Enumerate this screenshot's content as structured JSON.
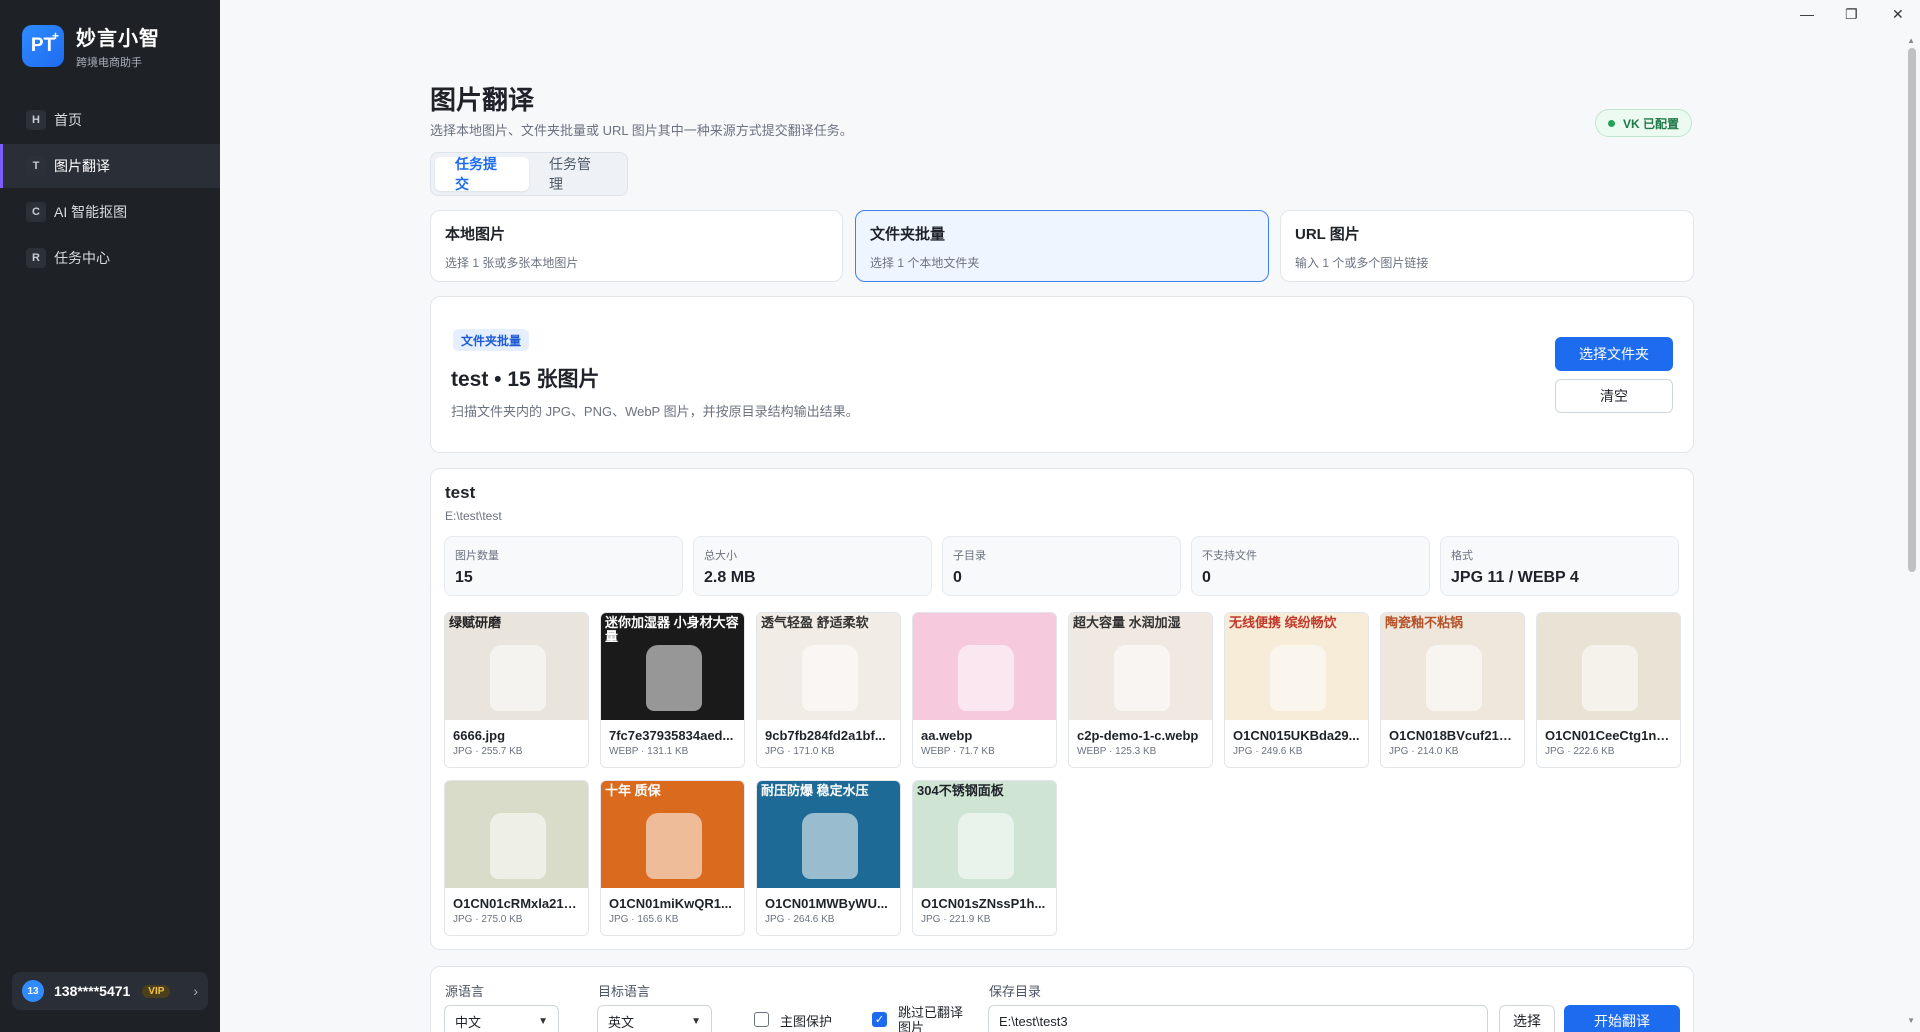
{
  "brand": {
    "logo": "PT",
    "name": "妙言小智",
    "subtitle": "跨境电商助手"
  },
  "nav": [
    {
      "key": "H",
      "label": "首页"
    },
    {
      "key": "T",
      "label": "图片翻译",
      "active": true
    },
    {
      "key": "C",
      "label": "AI 智能抠图"
    },
    {
      "key": "R",
      "label": "任务中心"
    }
  ],
  "user": {
    "avatar": "13",
    "phone": "138****5471",
    "badge": "VIP"
  },
  "window": {
    "minimize": "—",
    "restore": "❐",
    "close": "✕"
  },
  "page": {
    "title": "图片翻译",
    "subtitle": "选择本地图片、文件夹批量或 URL 图片其中一种来源方式提交翻译任务。",
    "vk_badge": "VK 已配置"
  },
  "tabs": [
    {
      "label": "任务提交",
      "active": true
    },
    {
      "label": "任务管理"
    }
  ],
  "sources": [
    {
      "title": "本地图片",
      "desc": "选择 1 张或多张本地图片"
    },
    {
      "title": "文件夹批量",
      "desc": "选择 1 个本地文件夹",
      "active": true
    },
    {
      "title": "URL 图片",
      "desc": "输入 1 个或多个图片链接"
    }
  ],
  "folder_panel": {
    "tag": "文件夹批量",
    "title": "test • 15 张图片",
    "desc": "扫描文件夹内的 JPG、PNG、WebP 图片，并按原目录结构输出结果。",
    "select_button": "选择文件夹",
    "clear_button": "清空"
  },
  "folder": {
    "name": "test",
    "path": "E:\\test\\test",
    "stats": [
      {
        "label": "图片数量",
        "value": "15"
      },
      {
        "label": "总大小",
        "value": "2.8 MB"
      },
      {
        "label": "子目录",
        "value": "0"
      },
      {
        "label": "不支持文件",
        "value": "0"
      },
      {
        "label": "格式",
        "value": "JPG 11 / WEBP 4"
      }
    ],
    "images": [
      {
        "name": "6666.jpg",
        "meta": "JPG · 255.7 KB",
        "caption": "绿赋研磨",
        "bg": "#e9e4dc",
        "fg": "#222"
      },
      {
        "name": "7fc7e37935834aed...",
        "meta": "WEBP · 131.1 KB",
        "caption": "迷你加湿器 小身材大容量",
        "bg": "#1a1a1a",
        "fg": "#ffffff"
      },
      {
        "name": "9cb7fb284fd2a1bf...",
        "meta": "JPG · 171.0 KB",
        "caption": "透气轻盈 舒适柔软",
        "bg": "#f1ece5",
        "fg": "#333"
      },
      {
        "name": "aa.webp",
        "meta": "WEBP · 71.7 KB",
        "caption": "",
        "bg": "#f7c9dd",
        "fg": "#c2185b"
      },
      {
        "name": "c2p-demo-1-c.webp",
        "meta": "WEBP · 125.3 KB",
        "caption": "超大容量 水润加湿",
        "bg": "#efe9e2",
        "fg": "#333"
      },
      {
        "name": "O1CN015UKBda29...",
        "meta": "JPG · 249.6 KB",
        "caption": "无线便携 缤纷畅饮",
        "bg": "#f6ecd8",
        "fg": "#c0392b"
      },
      {
        "name": "O1CN018BVcuf21s...",
        "meta": "JPG · 214.0 KB",
        "caption": "陶瓷釉不粘锅",
        "bg": "#efe7dc",
        "fg": "#b4532a"
      },
      {
        "name": "O1CN01CeeCtg1n7...",
        "meta": "JPG · 222.6 KB",
        "caption": "",
        "bg": "#e9e3d6",
        "fg": "#333"
      },
      {
        "name": "O1CN01cRMxla21s...",
        "meta": "JPG · 275.0 KB",
        "caption": "",
        "bg": "#d9dcc9",
        "fg": "#333"
      },
      {
        "name": "O1CN01miKwQR1...",
        "meta": "JPG · 165.6 KB",
        "caption": "十年 质保",
        "bg": "#d96a1e",
        "fg": "#ffffff"
      },
      {
        "name": "O1CN01MWByWU...",
        "meta": "JPG · 264.6 KB",
        "caption": "耐压防爆 稳定水压",
        "bg": "#1d6a96",
        "fg": "#ffffff"
      },
      {
        "name": "O1CN01sZNssP1h...",
        "meta": "JPG · 221.9 KB",
        "caption": "304不锈钢面板",
        "bg": "#cfe4d2",
        "fg": "#1f2329"
      }
    ]
  },
  "bottom": {
    "source_lang_label": "源语言",
    "source_lang": "中文",
    "target_lang_label": "目标语言",
    "target_lang": "英文",
    "subject_protect": "主图保护",
    "skip_translated": "跳过已翻译图片",
    "save_dir_label": "保存目录",
    "save_dir": "E:\\test\\test3",
    "choose_button": "选择",
    "start_button": "开始翻译"
  },
  "colors": {
    "accent": "#1d6cf0",
    "sidebar": "#1e2227",
    "success": "#22a35a"
  }
}
